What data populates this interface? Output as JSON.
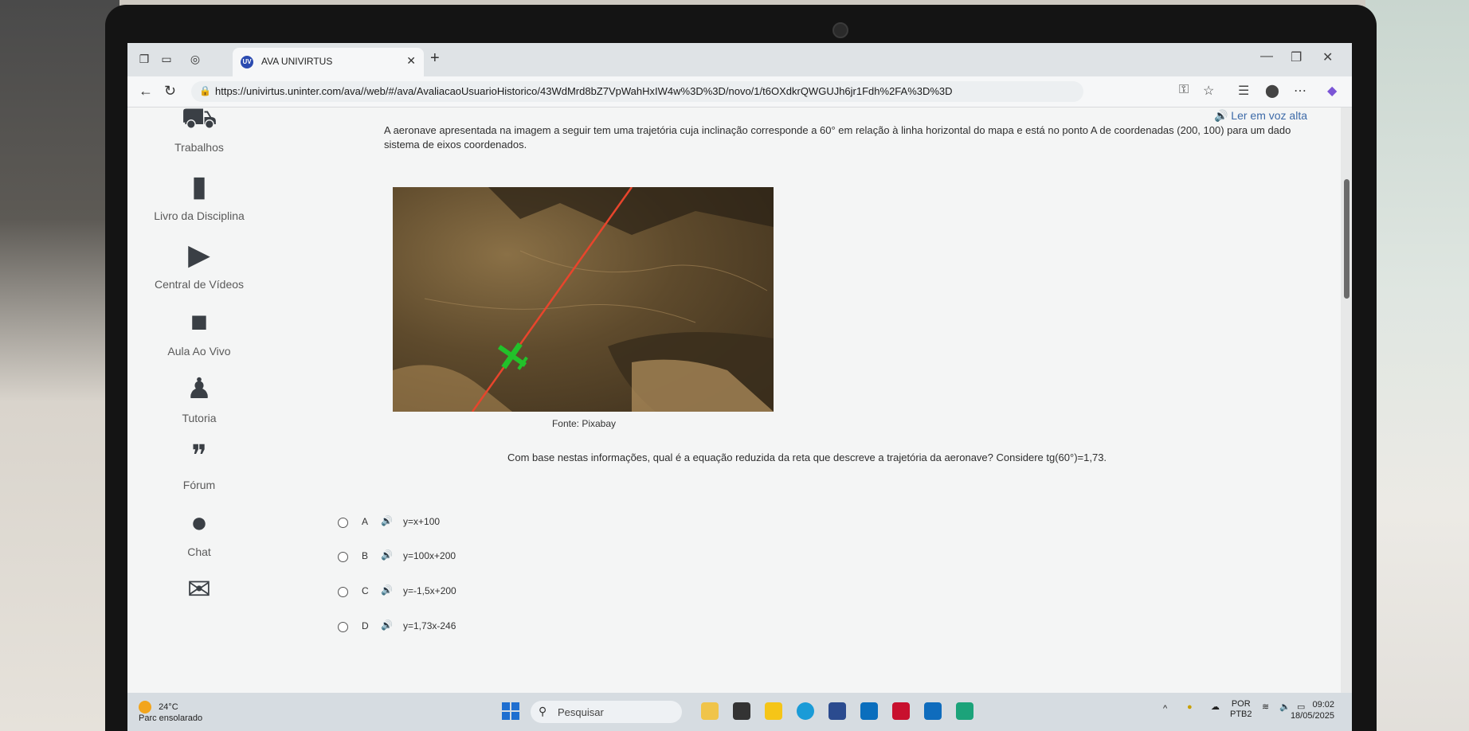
{
  "browser": {
    "tab_title": "AVA UNIVIRTUS",
    "url": "https://univirtus.uninter.com/ava//web/#/ava/AvaliacaoUsuarioHistorico/43WdMrd8bZ7VpWahHxIW4w%3D%3D/novo/1/t6OXdkrQWGUJh6jr1Fdh%2FA%3D%3D"
  },
  "sidebar": {
    "items": [
      {
        "label": "Trabalhos",
        "icon": "wheelbarrow-icon",
        "glyph": "⛟"
      },
      {
        "label": "Livro da Disciplina",
        "icon": "book-icon",
        "glyph": "▮"
      },
      {
        "label": "Central de Vídeos",
        "icon": "play-icon",
        "glyph": "▶"
      },
      {
        "label": "Aula Ao Vivo",
        "icon": "video-camera-icon",
        "glyph": "■"
      },
      {
        "label": "Tutoria",
        "icon": "graduate-icon",
        "glyph": "♟"
      },
      {
        "label": "Fórum",
        "icon": "quote-bubble-icon",
        "glyph": "❞"
      },
      {
        "label": "Chat",
        "icon": "chat-bubble-icon",
        "glyph": "●"
      },
      {
        "label": "",
        "icon": "envelope-icon",
        "glyph": "✉"
      }
    ]
  },
  "content": {
    "read_aloud": "Ler em voz alta",
    "question_text": "A aeronave apresentada na imagem a seguir tem uma trajetória cuja inclinação corresponde a 60° em relação à linha horizontal do mapa e está no ponto A de coordenadas (200, 100) para um dado sistema de eixos coordenados.",
    "image_caption": "Fonte: Pixabay",
    "prompt": "Com base nestas informações, qual é a equação reduzida da reta que descreve a trajetória da aeronave? Considere tg(60°)=1,73.",
    "options": [
      {
        "letter": "A",
        "text": "y=x+100"
      },
      {
        "letter": "B",
        "text": "y=100x+200"
      },
      {
        "letter": "C",
        "text": "y=-1,5x+200"
      },
      {
        "letter": "D",
        "text": "y=1,73x-246"
      }
    ]
  },
  "taskbar": {
    "weather_temp": "24°C",
    "weather_desc": "Parc ensolarado",
    "search_placeholder": "Pesquisar",
    "lang_top": "POR",
    "lang_bottom": "PTB2",
    "time": "09:02",
    "date": "18/05/2025",
    "notification_count": "1"
  },
  "colors": {
    "accent_blue": "#3d6aa8",
    "flight_path": "#e8452c",
    "plane": "#22c12a"
  }
}
